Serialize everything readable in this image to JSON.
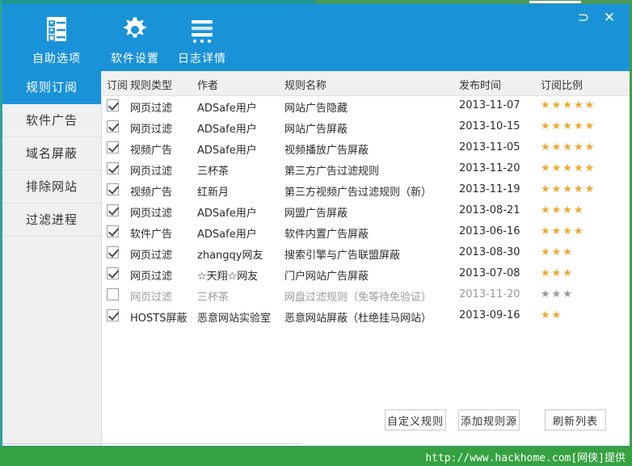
{
  "window": {
    "restore_icon": "⊃",
    "close_icon": "✕",
    "restore_label": "Restore",
    "close_label": "Close"
  },
  "toolbar": {
    "items": [
      {
        "label": "自助选项",
        "icon": "checklist-icon"
      },
      {
        "label": "软件设置",
        "icon": "gear-icon"
      },
      {
        "label": "日志详情",
        "icon": "log-lines-icon"
      }
    ]
  },
  "sidebar": {
    "items": [
      {
        "label": "规则订阅",
        "active": true
      },
      {
        "label": "软件广告",
        "active": false
      },
      {
        "label": "域名屏蔽",
        "active": false
      },
      {
        "label": "排除网站",
        "active": false
      },
      {
        "label": "过滤进程",
        "active": false
      }
    ]
  },
  "table": {
    "headers": {
      "subscribe": "订阅",
      "type": "规则类型",
      "author": "作者",
      "name": "规则名称",
      "date": "发布时间",
      "rate": "订阅比例"
    },
    "rows": [
      {
        "checked": true,
        "type": "网页过滤",
        "author": "ADSafe用户",
        "name": "网站广告隐藏",
        "date": "2013-11-07",
        "stars": 5
      },
      {
        "checked": true,
        "type": "网页过滤",
        "author": "ADSafe用户",
        "name": "网站广告屏蔽",
        "date": "2013-10-15",
        "stars": 5
      },
      {
        "checked": true,
        "type": "视频广告",
        "author": "ADSafe用户",
        "name": "视频播放广告屏蔽",
        "date": "2013-11-05",
        "stars": 5
      },
      {
        "checked": true,
        "type": "网页过滤",
        "author": "三杯茶",
        "name": "第三方广告过滤规则",
        "date": "2013-11-20",
        "stars": 5
      },
      {
        "checked": true,
        "type": "视频广告",
        "author": "红新月",
        "name": "第三方视频广告过滤规则（新）",
        "date": "2013-11-19",
        "stars": 5
      },
      {
        "checked": true,
        "type": "网页过滤",
        "author": "ADSafe用户",
        "name": "网盟广告屏蔽",
        "date": "2013-08-21",
        "stars": 4
      },
      {
        "checked": true,
        "type": "软件广告",
        "author": "ADSafe用户",
        "name": "软件内置广告屏蔽",
        "date": "2013-06-16",
        "stars": 4
      },
      {
        "checked": true,
        "type": "网页过滤",
        "author": "zhangqy网友",
        "name": "搜索引擎与广告联盟屏蔽",
        "date": "2013-08-30",
        "stars": 3
      },
      {
        "checked": true,
        "type": "网页过滤",
        "author": "☆天翔☆网友",
        "name": "门户网站广告屏蔽",
        "date": "2013-07-08",
        "stars": 3
      },
      {
        "checked": false,
        "type": "网页过滤",
        "author": "三杯茶",
        "name": "网盘过滤规则（免等待免验证）",
        "date": "2013-11-20",
        "stars": 3
      },
      {
        "checked": true,
        "type": "HOSTS屏蔽",
        "author": "恶意网站实验室",
        "name": "恶意网站屏蔽（杜绝挂马网站）",
        "date": "2013-09-16",
        "stars": 2
      }
    ],
    "star_glyph": "★"
  },
  "buttons": [
    {
      "label": "自定义规则"
    },
    {
      "label": "添加规则源"
    },
    {
      "label": "刷新列表"
    }
  ],
  "footer": {
    "watermark": "http://www.hackhome.com[网侠]提供"
  },
  "colors": {
    "accent_blue": "#1a92d8",
    "footer_green": "#35a241",
    "star_orange": "#f0a830",
    "border_teal": "#2aa39a"
  }
}
